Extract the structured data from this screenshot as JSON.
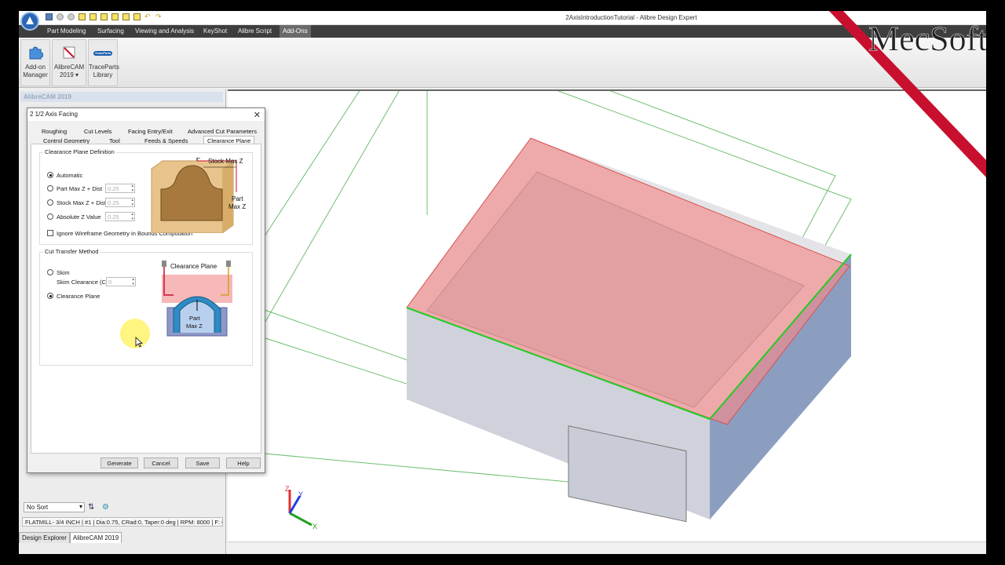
{
  "window": {
    "title": "2AxisIntroductionTutorial - Alibre Design Expert"
  },
  "menu_tabs": [
    "Part Modeling",
    "Surfacing",
    "Viewing and Analysis",
    "KeyShot",
    "Alibre Script",
    "Add-Ons"
  ],
  "active_tab": "Add-Ons",
  "ribbon": {
    "addon_manager": {
      "line1": "Add-on",
      "line2": "Manager"
    },
    "alibrecam": {
      "line1": "AlibreCAM",
      "line2": "2019 ▾"
    },
    "traceparts": {
      "line1": "TraceParts",
      "line2": "Library"
    },
    "traceparts_logo": "TraceParts"
  },
  "left_panel": {
    "header": "AlibreCAM 2019",
    "sort": "No Sort",
    "status": "FLATMILL- 3/4 INCH | #1 | Dia:0.75, CRad:0, Taper:0 deg | RPM: 8000 | F: 60",
    "bottom_tabs": [
      "Design Explorer",
      "AlibreCAM 2019"
    ]
  },
  "dialog": {
    "title": "2 1/2 Axis Facing",
    "tabs_row1": [
      "Roughing",
      "Cut Levels",
      "Facing Entry/Exit",
      "Advanced Cut Parameters"
    ],
    "tabs_row2": [
      "Control Geometry",
      "Tool",
      "Feeds & Speeds",
      "Clearance Plane"
    ],
    "selected_tab": "Clearance Plane",
    "cpd": {
      "group_label": "Clearance Plane Definition",
      "options": [
        {
          "label": "Automatic",
          "value": null,
          "selected": true
        },
        {
          "label": "Part Max Z + Dist",
          "value": "0.25",
          "selected": false
        },
        {
          "label": "Stock Max Z + Dist",
          "value": "0.25",
          "selected": false
        },
        {
          "label": "Absolute Z Value",
          "value": "0.25",
          "selected": false
        }
      ],
      "checkbox": "Ignore Wireframe Geometry in Bounds Computation",
      "diagram": {
        "stock_label": "Stock Max Z",
        "part_line1": "Part",
        "part_line2": "Max Z"
      }
    },
    "ctm": {
      "group_label": "Cut Transfer Method",
      "skim": "Skim",
      "skim_clearance_label": "Skim Clearance (C)",
      "skim_clearance_value": "0",
      "clearance_plane": "Clearance Plane",
      "selected": "Clearance Plane",
      "diagram": {
        "plane_label": "Clearance Plane",
        "part_line1": "Part",
        "part_line2": "Max Z"
      }
    },
    "buttons": [
      "Generate",
      "Cancel",
      "Save",
      "Help"
    ]
  },
  "watermark": "MecSoft",
  "axes": {
    "x": "X",
    "y": "Y",
    "z": "Z"
  },
  "colors": {
    "toolpath_red": "#f28b8b",
    "edge_green": "#22cc22",
    "brand_red": "#c8102e",
    "menubar": "#3e3e3e"
  }
}
